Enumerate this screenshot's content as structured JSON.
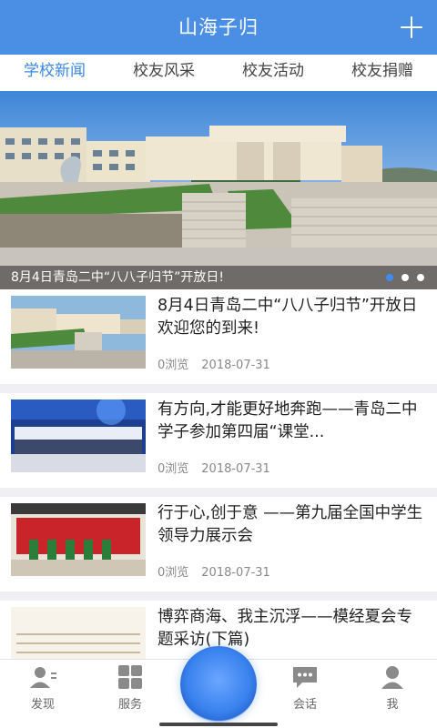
{
  "app": {
    "title": "山海子归"
  },
  "tabs": [
    {
      "label": "学校新闻",
      "active": true
    },
    {
      "label": "校友风采",
      "active": false
    },
    {
      "label": "校友活动",
      "active": false
    },
    {
      "label": "校友捐赠",
      "active": false
    }
  ],
  "banner": {
    "caption": "8月4日青岛二中“八八子归节”开放日!",
    "slide_count": 3,
    "active_slide": 1
  },
  "news": [
    {
      "headline": "8月4日青岛二中“八八子归节”开放日欢迎您的到来!",
      "views": "0浏览",
      "date": "2018-07-31"
    },
    {
      "headline": "有方向,才能更好地奔跑——青岛二中学子参加第四届“课堂...",
      "views": "0浏览",
      "date": "2018-07-31"
    },
    {
      "headline": "行于心,创于意 ——第九届全国中学生领导力展示会",
      "views": "0浏览",
      "date": "2018-07-31"
    },
    {
      "headline": "博弈商海、我主沉浮——模经夏会专题采访(下篇)",
      "views": "",
      "date": ""
    }
  ],
  "bottom_nav": {
    "discover": "发现",
    "service": "服务",
    "chat": "会话",
    "me": "我"
  },
  "colors": {
    "brand": "#4a8fe4",
    "active_tab": "#3b86e0"
  }
}
